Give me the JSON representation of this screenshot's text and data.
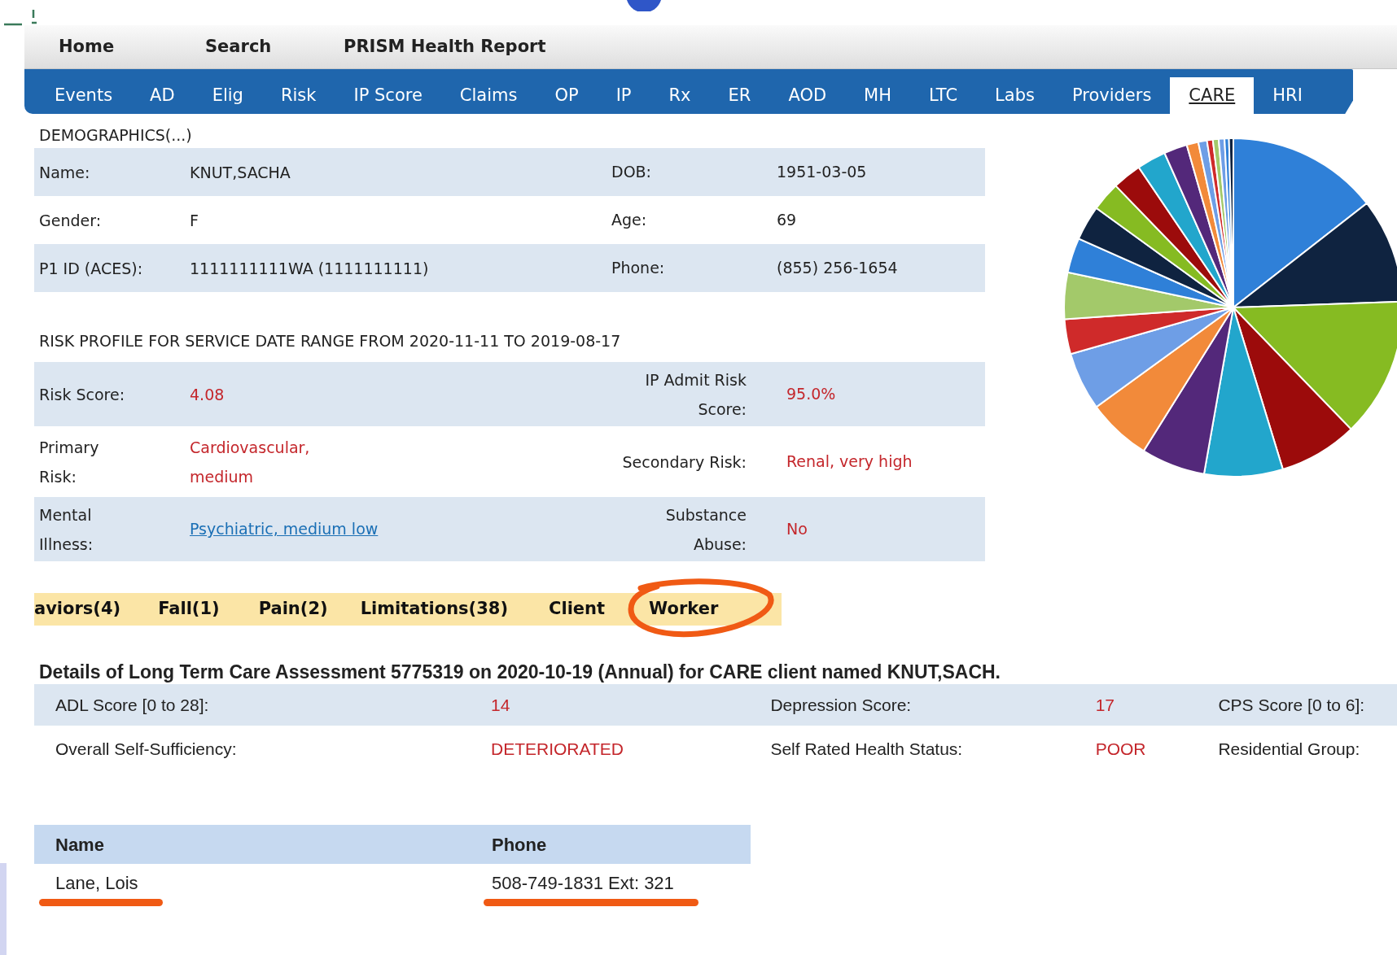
{
  "nav": [
    "Home",
    "Search",
    "PRISM Health Report"
  ],
  "tabs": [
    {
      "label": "Events",
      "selected": false
    },
    {
      "label": "AD",
      "selected": false
    },
    {
      "label": "Elig",
      "selected": false
    },
    {
      "label": "Risk",
      "selected": false
    },
    {
      "label": "IP Score",
      "selected": false
    },
    {
      "label": "Claims",
      "selected": false
    },
    {
      "label": "OP",
      "selected": false
    },
    {
      "label": "IP",
      "selected": false
    },
    {
      "label": "Rx",
      "selected": false
    },
    {
      "label": "ER",
      "selected": false
    },
    {
      "label": "AOD",
      "selected": false
    },
    {
      "label": "MH",
      "selected": false
    },
    {
      "label": "LTC",
      "selected": false
    },
    {
      "label": "Labs",
      "selected": false
    },
    {
      "label": "Providers",
      "selected": false
    },
    {
      "label": "CARE",
      "selected": true
    },
    {
      "label": "HRI",
      "selected": false
    }
  ],
  "demographics": {
    "title": "DEMOGRAPHICS(...)",
    "rows": [
      {
        "label": "Name:",
        "value": "KNUT,SACHA",
        "label_2": "DOB:",
        "value_2": "1951-03-05"
      },
      {
        "label": "Gender:",
        "value": "F",
        "label_2": "Age:",
        "value_2": "69"
      },
      {
        "label": "P1 ID (ACES):",
        "value": "1111111111WA (1111111111)",
        "label_2": "Phone:",
        "value_2": "(855) 256-1654"
      }
    ]
  },
  "risk_profile": {
    "title": "RISK PROFILE FOR SERVICE DATE RANGE FROM 2020-11-11 TO 2019-08-17",
    "rows": [
      {
        "label": "Risk Score:",
        "value": "4.08",
        "kind": "text",
        "label_2": "IP Admit Risk Score:",
        "value_2": "95.0%"
      },
      {
        "label": "Primary Risk:",
        "value": "Cardiovascular, medium",
        "kind": "text",
        "label_2": "Secondary Risk:",
        "value_2": "Renal, very high"
      },
      {
        "label": "Mental Illness:",
        "value": "Psychiatric, medium low",
        "kind": "link",
        "label_2": "Substance Abuse:",
        "value_2": "No"
      }
    ]
  },
  "care_tabs": [
    {
      "label": "aviors(4)",
      "circled": false
    },
    {
      "label": "Fall(1)",
      "circled": false
    },
    {
      "label": "Pain(2)",
      "circled": false
    },
    {
      "label": "Limitations(38)",
      "circled": false
    },
    {
      "label": "Client",
      "circled": false
    },
    {
      "label": "Worker",
      "circled": true
    }
  ],
  "assessment": {
    "heading": "Details of Long Term Care Assessment 5775319 on 2020-10-19 (Annual) for CARE client named KNUT,SACH.",
    "rows": [
      {
        "cells": [
          {
            "label": "ADL Score [0 to 28]:",
            "value": "14"
          },
          {
            "label": "Depression Score:",
            "value": "17"
          },
          {
            "label": "CPS Score [0 to 6]:"
          }
        ]
      },
      {
        "cells": [
          {
            "label": "Overall Self-Sufficiency:",
            "value": "DETERIORATED"
          },
          {
            "label": "Self Rated Health Status:",
            "value": "POOR"
          },
          {
            "label": "Residential Group:"
          }
        ]
      }
    ]
  },
  "workers": {
    "columns": [
      "Name",
      "Phone"
    ],
    "rows": [
      {
        "name": "Lane, Lois",
        "phone": "508-749-1831 Ext: 321",
        "marked": true
      }
    ]
  }
}
